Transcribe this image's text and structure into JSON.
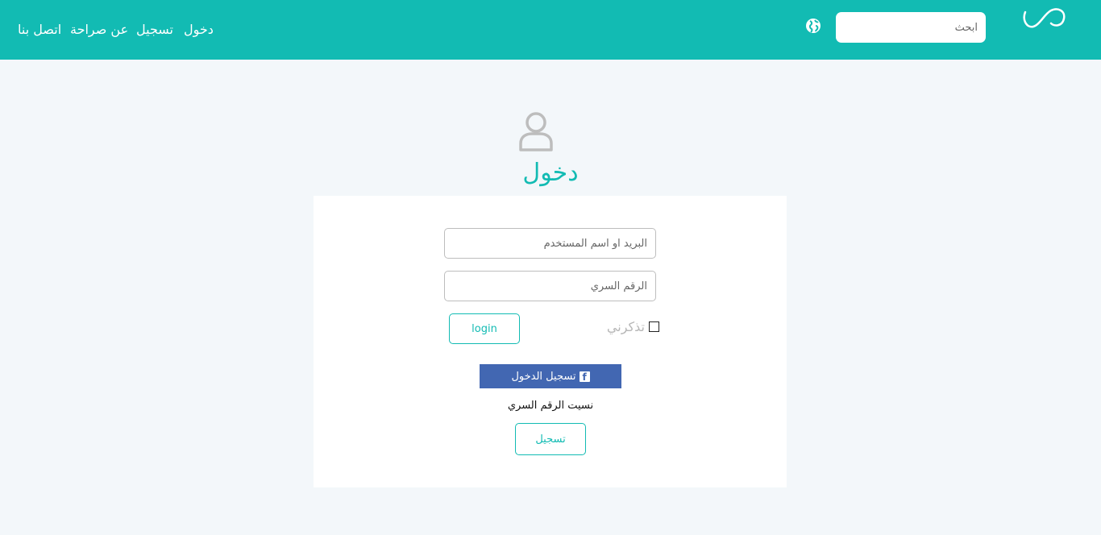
{
  "header": {
    "search_placeholder": "ابحث",
    "nav": {
      "login": "دخول",
      "register": "تسجيل",
      "about": "عن صراحة",
      "contact": "اتصل بنا"
    }
  },
  "main": {
    "title": "دخول",
    "email_placeholder": "البريد او اسم المستخدم",
    "password_placeholder": "الرقم السري",
    "remember_label": "تذكرني",
    "login_button": "login",
    "facebook_button": "تسجيل الدخول",
    "forgot_link": "نسيت الرقم السري",
    "register_button": "تسجيل"
  },
  "colors": {
    "accent": "#12bbb3",
    "facebook": "#4267b2",
    "background": "#f3f7fa"
  },
  "icons": {
    "logo": "infinity-logo",
    "globe": "globe-icon",
    "user": "user-icon",
    "facebook": "facebook-icon"
  }
}
